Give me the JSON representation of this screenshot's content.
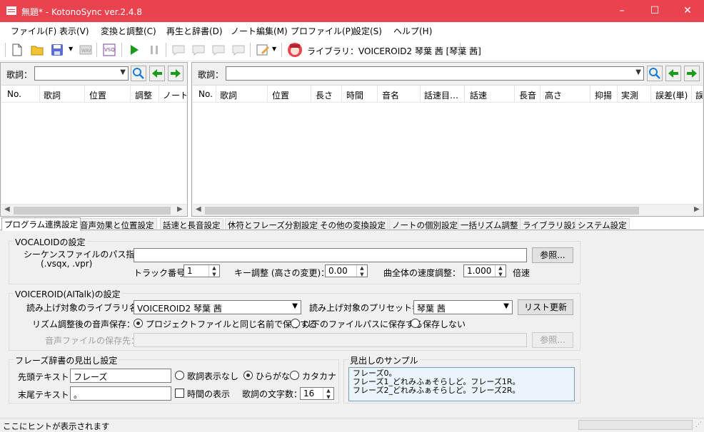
{
  "window": {
    "title": "無題* - KotonoSync ver.2.4.8",
    "minimize": "–",
    "maximize": "☐",
    "close": "✕"
  },
  "menu": [
    "ファイル(F)",
    "表示(V)",
    "変換と調整(C)",
    "再生と辞書(D)",
    "ノート編集(M)",
    "プロファイル(P)",
    "設定(S)",
    "ヘルプ(H)"
  ],
  "toolbar": {
    "library_label": "ライブラリ：VOICEROID2 琴葉 茜 [琴葉 茜]"
  },
  "left_pane": {
    "lyric_label": "歌詞：",
    "lyric_value": "",
    "columns": [
      "No.",
      "歌詞",
      "位置",
      "調整",
      "ノート数"
    ]
  },
  "right_pane": {
    "lyric_label": "歌詞：",
    "lyric_value": "",
    "columns": [
      "No.",
      "歌詞",
      "位置",
      "長さ",
      "時間",
      "音名",
      "話速目…",
      "話速",
      "長音",
      "高さ",
      "抑揚",
      "実測",
      "誤差(単)",
      "誤"
    ]
  },
  "tabs": [
    "プログラム連携設定",
    "音声効果と位置設定",
    "話速と長音設定",
    "休符とフレーズ分割設定",
    "その他の変換設定",
    "ノートの個別設定",
    "一括リズム調整",
    "ライブラリ設定",
    "システム設定"
  ],
  "vocaloid": {
    "title": "VOCALOIDの設定",
    "seq_path_label": "シーケンスファイルのパス指定：",
    "seq_path_hint": "(.vsqx, .vpr)",
    "seq_path_value": "",
    "browse": "参照...",
    "track_label": "トラック番号：",
    "track_value": "1",
    "key_label": "キー調整 (高さの変更)：",
    "key_value": "0.00",
    "speed_label": "曲全体の速度調整：",
    "speed_value": "1.000",
    "speed_unit": "倍速"
  },
  "voiceroid": {
    "title": "VOICEROID(AITalk)の設定",
    "library_label": "読み上げ対象のライブラリ名：",
    "library_value": "VOICEROID2 琴葉 茜",
    "preset_label": "読み上げ対象のプリセット名：",
    "preset_value": "琴葉 茜",
    "refresh": "リスト更新",
    "save_label": "リズム調整後の音声保存：",
    "save_options": [
      "プロジェクトファイルと同じ名前で保存する",
      "以下のファイルパスに保存する",
      "保存しない"
    ],
    "save_selected": 0,
    "dest_label": "音声ファイルの保存先：",
    "dest_value": "",
    "dest_browse": "参照..."
  },
  "phrase": {
    "title": "フレーズ辞書の見出し設定",
    "head_label": "先頭テキスト：",
    "head_value": "フレーズ",
    "tail_label": "末尾テキスト：",
    "tail_value": "。",
    "display_options": [
      "歌詞表示なし",
      "ひらがな",
      "カタカナ"
    ],
    "display_selected": 1,
    "time_label": "時間の表示",
    "time_checked": false,
    "chars_label": "歌詞の文字数：",
    "chars_value": "16"
  },
  "sample": {
    "title": "見出しのサンプル",
    "lines": [
      "フレーズ0。",
      "フレーズ1_どれみふぁそらしど。フレーズ1R。",
      "フレーズ2_どれみふぁそらしど。フレーズ2R。"
    ]
  },
  "status": {
    "hint": "ここにヒントが表示されます"
  },
  "colors": {
    "titlebar": "#e8434f",
    "play": "#1a9c1a",
    "arrow_green": "#1a9c1a"
  }
}
